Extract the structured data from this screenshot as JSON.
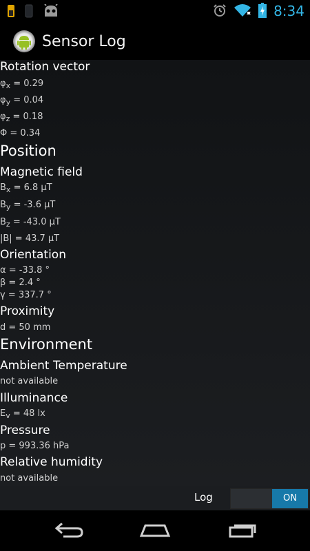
{
  "status_bar": {
    "time": "8:34",
    "left_icons": [
      "sim-toolkit-icon",
      "phone-icon",
      "android-debug-icon"
    ],
    "right_icons": [
      "alarm-icon",
      "wifi-icon",
      "battery-charging-icon"
    ]
  },
  "app": {
    "title": "Sensor Log",
    "icon": "android-icon"
  },
  "sections": {
    "rotation_vector": {
      "title": "Rotation vector",
      "phi_x": {
        "symbol": "φ",
        "sub": "x",
        "rest": " = 0.29"
      },
      "phi_y": {
        "symbol": "φ",
        "sub": "y",
        "rest": " = 0.04"
      },
      "phi_z": {
        "symbol": "φ",
        "sub": "z",
        "rest": " = 0.18"
      },
      "phi_total": "Φ = 0.34"
    },
    "position": {
      "title": "Position",
      "magnetic_field": {
        "title": "Magnetic field",
        "bx": {
          "symbol": "B",
          "sub": "x",
          "rest": " = 6.8 µT"
        },
        "by": {
          "symbol": "B",
          "sub": "y",
          "rest": " = -3.6 µT"
        },
        "bz": {
          "symbol": "B",
          "sub": "z",
          "rest": " = -43.0 µT"
        },
        "b_total": "|B| = 43.7 µT"
      },
      "orientation": {
        "title": "Orientation",
        "alpha": "α = -33.8 °",
        "beta": "β = 2.4 °",
        "gamma": "γ = 337.7 °"
      },
      "proximity": {
        "title": "Proximity",
        "distance": "d = 50 mm"
      }
    },
    "environment": {
      "title": "Environment",
      "ambient_temperature": {
        "title": "Ambient Temperature",
        "value": "not available"
      },
      "illuminance": {
        "title": "Illuminance",
        "value": {
          "symbol": "E",
          "sub": "v",
          "rest": " = 48 lx"
        }
      },
      "pressure": {
        "title": "Pressure",
        "value": "p = 993.36 hPa"
      },
      "relative_humidity": {
        "title": "Relative humidity",
        "value": "not available"
      }
    }
  },
  "log": {
    "label": "Log",
    "toggle_state": "ON"
  },
  "nav_bar": {
    "buttons": [
      "back-icon",
      "home-icon",
      "recent-apps-icon"
    ]
  },
  "colors": {
    "accent": "#33b5e5",
    "toggle_on": "#1779a9",
    "background": "#111315"
  }
}
